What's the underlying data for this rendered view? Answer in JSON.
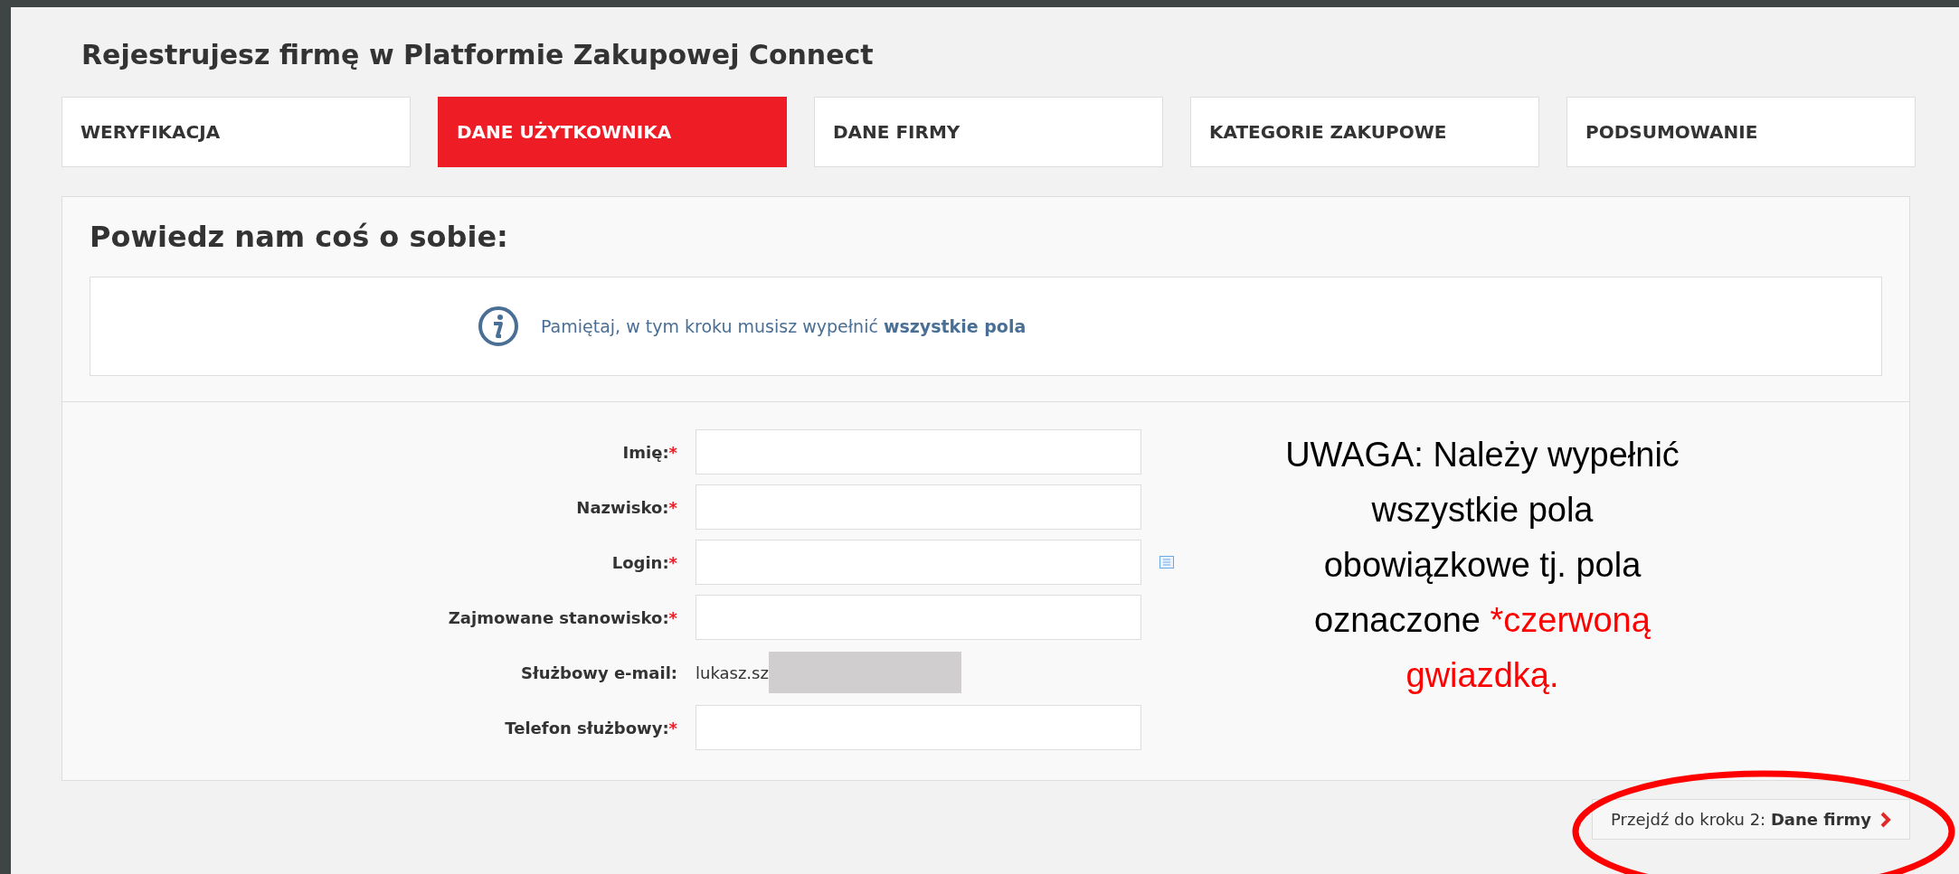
{
  "page_title": "Rejestrujesz firmę w Platformie Zakupowej Connect",
  "steps": [
    {
      "label": "WERYFIKACJA",
      "selected": false
    },
    {
      "label": "DANE UŻYTKOWNIKA",
      "selected": true
    },
    {
      "label": "DANE FIRMY",
      "selected": false
    },
    {
      "label": "KATEGORIE ZAKUPOWE",
      "selected": false
    },
    {
      "label": "PODSUMOWANIE",
      "selected": false
    }
  ],
  "section_heading": "Powiedz nam coś o sobie:",
  "info": {
    "text": "Pamiętaj, w tym kroku musisz wypełnić **wszystkie pola**"
  },
  "fields": [
    {
      "label": "Imię:",
      "required_mark": "*",
      "kind": "input",
      "hint_icon": false
    },
    {
      "label": "Nazwisko:",
      "required_mark": "*",
      "kind": "input",
      "hint_icon": false
    },
    {
      "label": "Login:",
      "required_mark": "*",
      "kind": "input",
      "hint_icon": true
    },
    {
      "label": "Zajmowane stanowisko:",
      "required_mark": "*",
      "kind": "input",
      "hint_icon": false
    },
    {
      "label": "Służbowy e-mail:",
      "kind": "text",
      "value": "lukasz.sz",
      "redacted": true
    },
    {
      "label": "Telefon służbowy:",
      "required_mark": "*",
      "kind": "input",
      "hint_icon": false
    }
  ],
  "note": {
    "text": "UWAGA: Należy wypełnić wszystkie pola obowiązkowe tj. pola oznaczone",
    "highlight": "*czerwoną gwiazdką."
  },
  "next_button": {
    "text": "Przejdź do kroku 2: **Dane firmy**"
  }
}
